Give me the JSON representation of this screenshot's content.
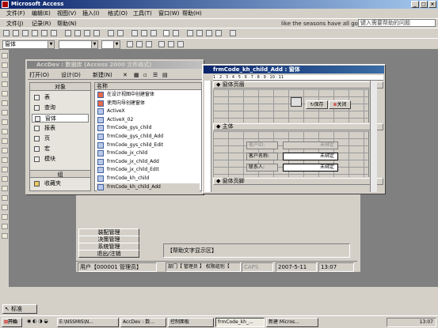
{
  "app": {
    "title": "Microsoft Access",
    "help_placeholder": "键入需要帮助的问题",
    "banner": "like the seasons have all gone"
  },
  "menu1": [
    "文件(F)",
    "编辑(E)",
    "视图(V)",
    "插入(I)",
    "格式(O)",
    "工具(T)",
    "窗口(W)",
    "帮助(H)"
  ],
  "menu2": [
    "文件(J)",
    "记录(R)",
    "帮助(N)"
  ],
  "format": {
    "object_combo": "窗体"
  },
  "db": {
    "title": "AccDev : 数据库 (Access 2000 文件格式)",
    "toolbar": {
      "open": "打开(O)",
      "design": "设计(D)",
      "new": "新建(N)"
    },
    "objects_header": "对象",
    "objects": [
      "表",
      "查询",
      "窗体",
      "报表",
      "页",
      "宏",
      "模块"
    ],
    "groups_header": "组",
    "favorites": "收藏夹",
    "list_header": "名称",
    "items": [
      "在设计视图中创建窗体",
      "使用向导创建窗体",
      "ActiveX",
      "ActiveX_02",
      "frmCode_gys_child",
      "frmCode_gys_child_Add",
      "frmCode_gys_child_Edit",
      "frmCode_jx_child",
      "frmCode_jx_child_Add",
      "frmCode_jx_child_Edit",
      "frmCode_kh_child",
      "frmCode_kh_child_Add"
    ]
  },
  "design": {
    "title": "frmCode_kh_child_Add : 窗体",
    "ruler": "1 · 2 · 3 · 4 · 5 · 6 · 7 · 8 · 9 · 10 · 11",
    "header_section": "窗体页眉",
    "body_section": "主体",
    "footer_section": "窗体页脚",
    "save_button": "保存",
    "close_button": "关闭",
    "labels": [
      "客户ID:",
      "客户名称:",
      "联系人:"
    ],
    "unbound": [
      "未绑定",
      "未绑定",
      "未绑定"
    ]
  },
  "main_form": {
    "side_buttons": [
      "装配管理",
      "决策管理",
      "系统管理",
      "退出/注销"
    ],
    "help_text": "【帮助文字显示区】",
    "status": {
      "user": "用户【000001 管理员】",
      "dept": "部门【 管理员 】 权限组别【",
      "caps": "CAPS",
      "date": "2007-5-11",
      "time": "13:07"
    }
  },
  "statusbar": {
    "mode": "标准"
  },
  "taskbar": {
    "start": "开始",
    "tasks": [
      "E:\\NSSMIS\\N...",
      "AccDev : 数...",
      "控制面板",
      "frmCode_kh_...",
      "新建 Micros..."
    ],
    "clock": "13:07"
  }
}
